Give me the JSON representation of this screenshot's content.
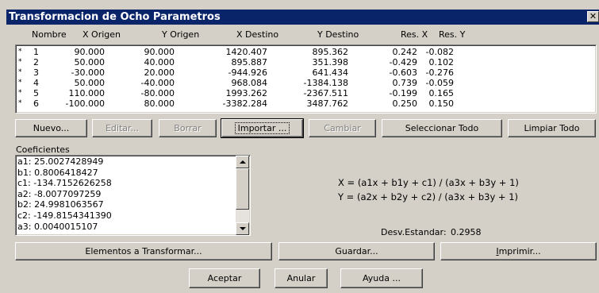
{
  "window": {
    "title": "Transformacion de Ocho Parametros",
    "close_glyph": "✕"
  },
  "table": {
    "headers": [
      "Nombre",
      "X Origen",
      "Y Origen",
      "X Destino",
      "Y Destino",
      "Res. X",
      "Res. Y"
    ],
    "rows": [
      [
        "*",
        "1",
        "90.000",
        "90.000",
        "1420.407",
        "895.362",
        "0.242",
        "-0.082"
      ],
      [
        "*",
        "2",
        "50.000",
        "40.000",
        "895.887",
        "351.398",
        "-0.429",
        "0.102"
      ],
      [
        "*",
        "3",
        "-30.000",
        "20.000",
        "-944.926",
        "641.434",
        "-0.603",
        "-0.276"
      ],
      [
        "*",
        "4",
        "50.000",
        "-40.000",
        "968.084",
        "-1384.138",
        "0.739",
        "-0.059"
      ],
      [
        "*",
        "5",
        "110.000",
        "-80.000",
        "1993.262",
        "-2367.511",
        "-0.199",
        "0.165"
      ],
      [
        "*",
        "6",
        "-100.000",
        "80.000",
        "-3382.284",
        "3487.762",
        "0.250",
        "0.150"
      ]
    ]
  },
  "buttons": {
    "nuevo": "Nuevo...",
    "editar": "Editar...",
    "borrar": "Borrar",
    "importar": "Importar ...",
    "cambiar": "Cambiar",
    "seleccionar_todo": "Seleccionar Todo",
    "limpiar_todo": "Limpiar Todo",
    "elementos": "Elementos a Transformar...",
    "guardar": "Guardar...",
    "imprimir": "Imprimir...",
    "aceptar": "Aceptar",
    "anular": "Anular",
    "ayuda": "Ayuda ..."
  },
  "coeficientes": {
    "label": "Coeficientes",
    "items": [
      "a1: 25.0027428949",
      "b1: 0.8006418427",
      "c1: -134.7152626258",
      "a2: -8.0077097259",
      "b2: 24.9981063567",
      "c2: -149.8154341390",
      "a3: 0.0040015107"
    ]
  },
  "formulas": {
    "x": "X = (a1x + b1y + c1) / (a3x + b3y + 1)",
    "y": "Y = (a2x + b2y + c2) / (a3x + b3y + 1)"
  },
  "desv": {
    "label": "Desv.Estandar:",
    "value": "0.2958"
  }
}
